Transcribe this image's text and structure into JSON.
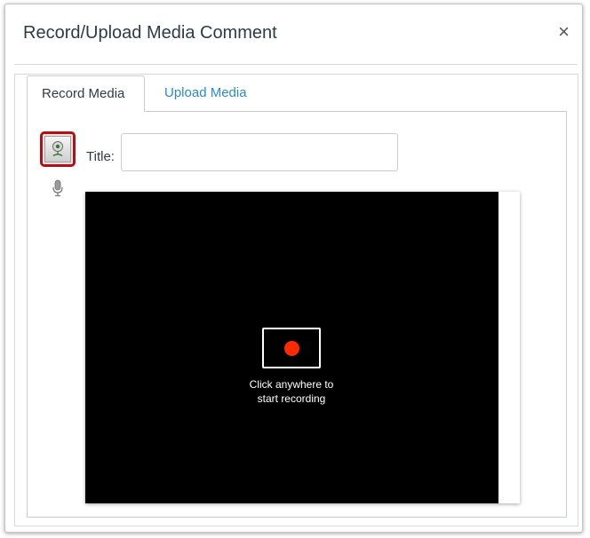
{
  "dialog": {
    "title": "Record/Upload Media Comment",
    "close_label": "×"
  },
  "tabs": [
    {
      "label": "Record Media",
      "active": true
    },
    {
      "label": "Upload Media",
      "active": false
    }
  ],
  "record_form": {
    "title_label": "Title:",
    "title_value": "",
    "title_placeholder": ""
  },
  "recorder": {
    "hint_line1": "Click anywhere to",
    "hint_line2": "start recording",
    "record_color": "#ff2a00"
  },
  "icons": {
    "webcam": "webcam-icon",
    "microphone": "microphone-icon",
    "record": "record-dot-icon",
    "close": "close-icon"
  },
  "colors": {
    "accent_link": "#2a8ad4",
    "selected_border": "#b40f16",
    "text": "#2d3b45"
  }
}
